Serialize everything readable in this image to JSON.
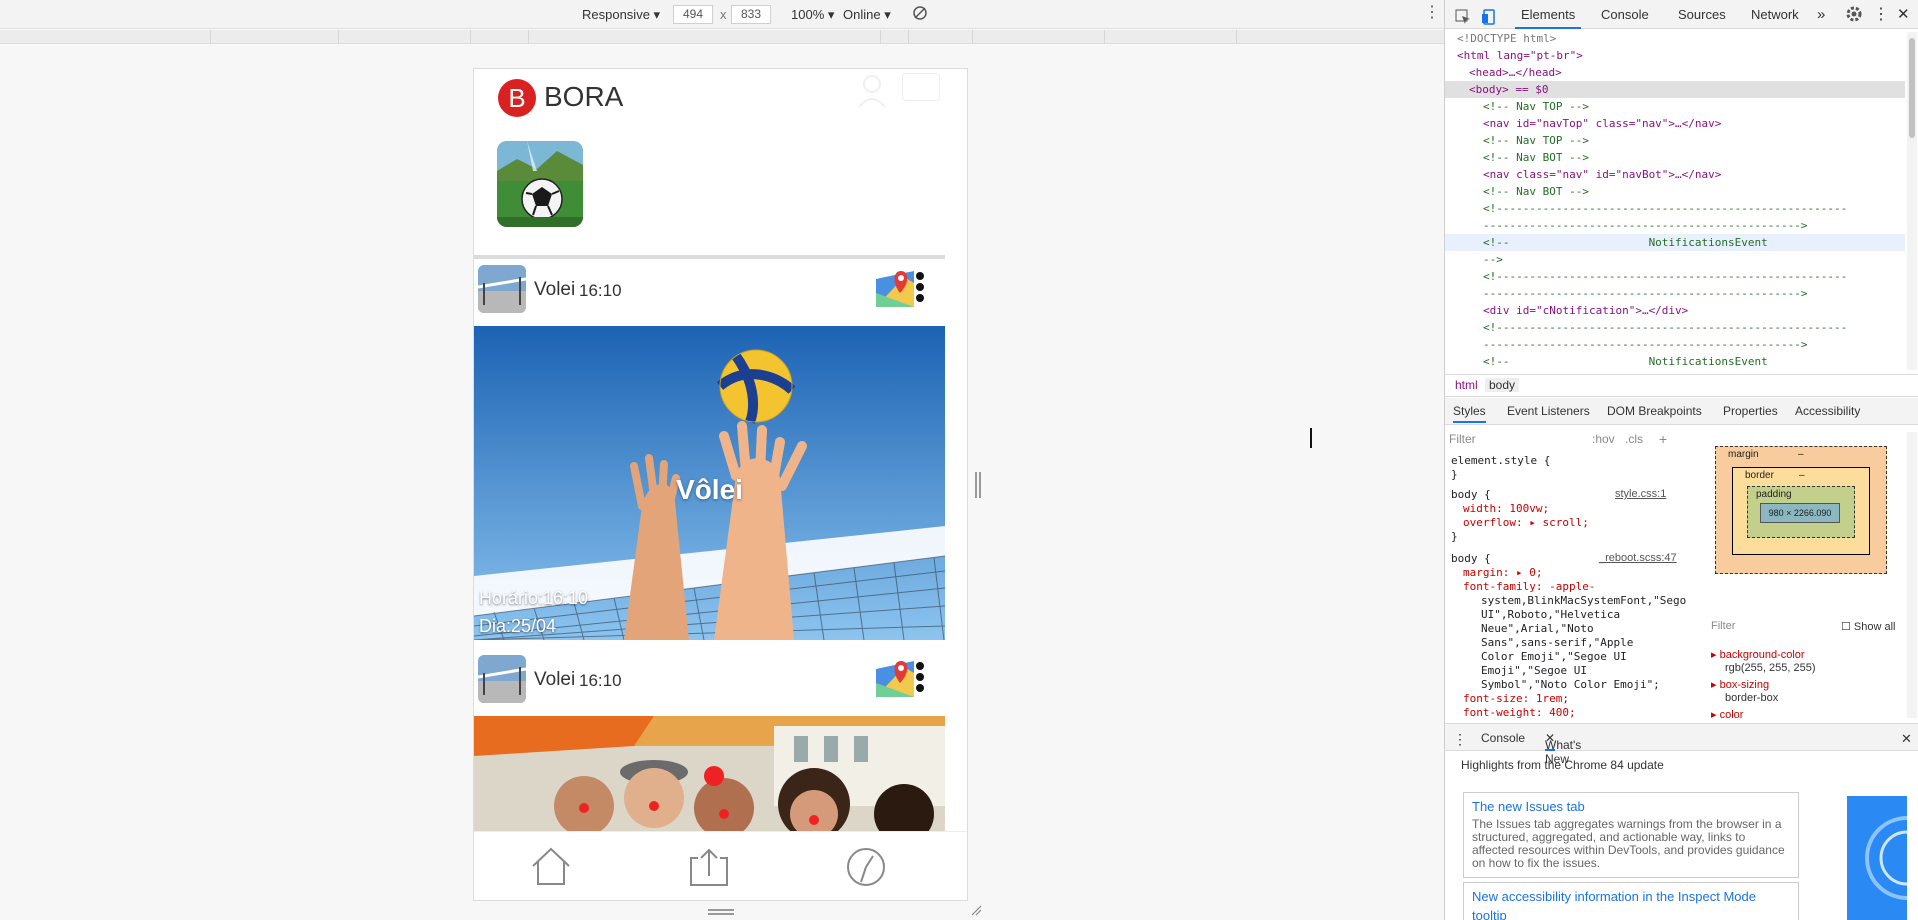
{
  "device_toolbar": {
    "mode": "Responsive",
    "width": "494",
    "times": "x",
    "height": "833",
    "zoom": "100%",
    "network": "Online"
  },
  "app": {
    "logo_letter": "B",
    "title": "BORA",
    "posts": [
      {
        "title": "Volei",
        "time": "16:10",
        "overlay_title": "Vôlei",
        "hour_label": "Horário:16:10",
        "day_label": "Dia:25/04"
      },
      {
        "title": "Volei",
        "time": "16:10"
      }
    ]
  },
  "devtools": {
    "tabs": [
      "Elements",
      "Console",
      "Sources",
      "Network",
      "»"
    ],
    "dom_lines": [
      "<!DOCTYPE html>",
      "<html lang=\"pt-br\">",
      "<head>…</head>",
      "<body> == $0",
      "<!-- Nav TOP -->",
      "<nav id=\"navTop\" class=\"nav\">…</nav>",
      "<!-- Nav TOP -->",
      "<!-- Nav BOT -->",
      "<nav class=\"nav\" id=\"navBot\">…</nav>",
      "<!-- Nav BOT -->",
      "<!-----------------------------------------------------",
      "------------------------------------------------>",
      "<!--                     NotificationsEvent",
      "-->",
      "<!-----------------------------------------------------",
      "------------------------------------------------>",
      "<div id=\"cNotification\">…</div>",
      "<!-----------------------------------------------------",
      "------------------------------------------------>",
      "<!--                     NotificationsEvent"
    ],
    "breadcrumbs": [
      "html",
      "body"
    ],
    "subtabs": [
      "Styles",
      "Event Listeners",
      "DOM Breakpoints",
      "Properties",
      "Accessibility"
    ],
    "styles_filter_placeholder": "Filter",
    "hov": ":hov",
    "cls": ".cls",
    "add": "+",
    "rules": {
      "element_style": "element.style {",
      "close": "}",
      "r1_selector": "body {",
      "r1_src": "style.css:1",
      "r1_p1": "width: 100vw;",
      "r1_p2": "overflow: ▸ scroll;",
      "r2_selector": "body {",
      "r2_src": "_reboot.scss:47",
      "r2_p1": "margin: ▸ 0;",
      "r2_p2": "font-family: -apple-",
      "r2_p2b": "system,BlinkMacSystemFont,\"Sego",
      "r2_p2c": "UI\",Roboto,\"Helvetica",
      "r2_p2d": "Neue\",Arial,\"Noto",
      "r2_p2e": "Sans\",sans-serif,\"Apple",
      "r2_p2f": "Color Emoji\",\"Segoe UI",
      "r2_p2g": "Emoji\",\"Segoe UI",
      "r2_p2h": "Symbol\",\"Noto Color Emoji\";",
      "r2_p3": "font-size: 1rem;",
      "r2_p4": "font-weight: 400;"
    },
    "box_model": {
      "margin": "margin",
      "border": "border",
      "padding": "padding",
      "content": "980 × 2266.090",
      "dash": "–"
    },
    "computed": {
      "filter": "Filter",
      "show_all": "Show all",
      "bg_name": "background-color",
      "bg_value": "rgb(255, 255, 255)",
      "bs_name": "box-sizing",
      "bs_value": "border-box",
      "color_name": "color"
    },
    "drawer_tabs": [
      "Console",
      "What's New"
    ],
    "whats_new": {
      "headline": "Highlights from the Chrome 84 update",
      "card1_title": "The new Issues tab",
      "card1_text": "The Issues tab aggregates warnings from the browser in a structured, aggregated, and actionable way, links to affected resources within DevTools, and provides guidance on how to fix the issues.",
      "card2_title": "New accessibility information in the Inspect Mode",
      "card2_title_2": "tooltip"
    }
  }
}
